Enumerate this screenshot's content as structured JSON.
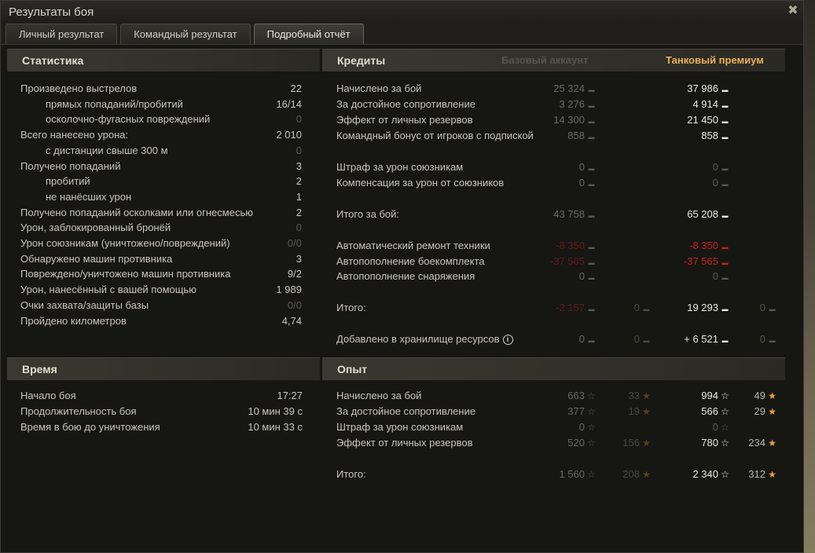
{
  "window": {
    "title": "Результаты боя"
  },
  "tabs": [
    "Личный результат",
    "Командный результат",
    "Подробный отчёт"
  ],
  "stats": {
    "title": "Статистика",
    "rows": [
      {
        "label": "Произведено выстрелов",
        "value": "22",
        "indent": false,
        "dim": false
      },
      {
        "label": "прямых попаданий/пробитий",
        "value": "16/14",
        "indent": true,
        "dim": false
      },
      {
        "label": "осколочно-фугасных повреждений",
        "value": "0",
        "indent": true,
        "dim": true
      },
      {
        "label": "Всего нанесено урона:",
        "value": "2 010",
        "indent": false,
        "dim": false
      },
      {
        "label": "с дистанции свыше 300 м",
        "value": "0",
        "indent": true,
        "dim": true
      },
      {
        "label": "Получено попаданий",
        "value": "3",
        "indent": false,
        "dim": false
      },
      {
        "label": "пробитий",
        "value": "2",
        "indent": true,
        "dim": false
      },
      {
        "label": "не нанёсших урон",
        "value": "1",
        "indent": true,
        "dim": false
      },
      {
        "label": "Получено попаданий осколками или огнесмесью",
        "value": "2",
        "indent": false,
        "dim": false
      },
      {
        "label": "Урон, заблокированный бронёй",
        "value": "0",
        "indent": false,
        "dim": true
      },
      {
        "label": "Урон союзникам (уничтожено/повреждений)",
        "value": "0/0",
        "indent": false,
        "dim": true
      },
      {
        "label": "Обнаружено машин противника",
        "value": "3",
        "indent": false,
        "dim": false
      },
      {
        "label": "Повреждено/уничтожено машин противника",
        "value": "9/2",
        "indent": false,
        "dim": false
      },
      {
        "label": "Урон, нанесённый с вашей помощью",
        "value": "1 989",
        "indent": false,
        "dim": false
      },
      {
        "label": "Очки захвата/защиты базы",
        "value": "0/0",
        "indent": false,
        "dim": true
      },
      {
        "label": "Пройдено километров",
        "value": "4,74",
        "indent": false,
        "dim": false
      }
    ]
  },
  "time": {
    "title": "Время",
    "rows": [
      {
        "label": "Начало боя",
        "value": "17:27"
      },
      {
        "label": "Продолжительность боя",
        "value": "10 мин 39 с"
      },
      {
        "label": "Время в бою до уничтожения",
        "value": "10 мин 33 с"
      }
    ]
  },
  "credits": {
    "title": "Кредиты",
    "col_basic": "Базовый аккаунт",
    "col_premium": "Танковый премиум",
    "rows": [
      {
        "label": "Начислено за бой",
        "basic": "25 324",
        "premium": "37 986",
        "basic_gold": "",
        "premium_gold": "",
        "style": "normal"
      },
      {
        "label": "За достойное сопротивление",
        "basic": "3 276",
        "premium": "4 914",
        "basic_gold": "",
        "premium_gold": "",
        "style": "normal"
      },
      {
        "label": "Эффект от личных резервов",
        "basic": "14 300",
        "premium": "21 450",
        "basic_gold": "",
        "premium_gold": "",
        "style": "normal"
      },
      {
        "label": "Командный бонус от игроков с подпиской",
        "basic": "858",
        "premium": "858",
        "basic_gold": "",
        "premium_gold": "",
        "style": "normal"
      },
      {
        "label": "Штраф за урон союзникам",
        "basic": "0",
        "premium": "0",
        "basic_gold": "",
        "premium_gold": "",
        "style": "zero"
      },
      {
        "label": "Компенсация за урон от союзников",
        "basic": "0",
        "premium": "0",
        "basic_gold": "",
        "premium_gold": "",
        "style": "zero"
      },
      {
        "label": "Итого за бой:",
        "basic": "43 758",
        "premium": "65 208",
        "basic_gold": "",
        "premium_gold": "",
        "style": "normal"
      },
      {
        "label": "Автоматический ремонт техники",
        "basic": "-8 350",
        "premium": "-8 350",
        "basic_gold": "",
        "premium_gold": "",
        "style": "red"
      },
      {
        "label": "Автопополнение боекомплекта",
        "basic": "-37 565",
        "premium": "-37 565",
        "basic_gold": "",
        "premium_gold": "",
        "style": "red"
      },
      {
        "label": "Автопополнение снаряжения",
        "basic": "0",
        "premium": "0",
        "basic_gold": "",
        "premium_gold": "",
        "style": "zero"
      },
      {
        "label": "Итого:",
        "basic": "-2 157",
        "premium": "19 293",
        "basic_gold": "0",
        "premium_gold": "0",
        "style": "total"
      },
      {
        "label": "Добавлено в хранилище ресурсов",
        "basic": "0",
        "premium": "+ 6 521",
        "basic_gold": "0",
        "premium_gold": "0",
        "style": "storage"
      }
    ]
  },
  "xp": {
    "title": "Опыт",
    "rows": [
      {
        "label": "Начислено за бой",
        "basic": "663",
        "basic_free": "33",
        "premium": "994",
        "premium_free": "49"
      },
      {
        "label": "За достойное сопротивление",
        "basic": "377",
        "basic_free": "19",
        "premium": "566",
        "premium_free": "29"
      },
      {
        "label": "Штраф за урон союзникам",
        "basic": "0",
        "basic_free": "",
        "premium": "0",
        "premium_free": ""
      },
      {
        "label": "Эффект от личных резервов",
        "basic": "520",
        "basic_free": "156",
        "premium": "780",
        "premium_free": "234"
      },
      {
        "label": "Итого:",
        "basic": "1 560",
        "basic_free": "208",
        "premium": "2 340",
        "premium_free": "312"
      }
    ]
  },
  "colors": {
    "window_bg": "#1f1e1b",
    "header_bg": "#3a3830",
    "premium_header": "#e8b05a",
    "negative": "#c8221d"
  }
}
